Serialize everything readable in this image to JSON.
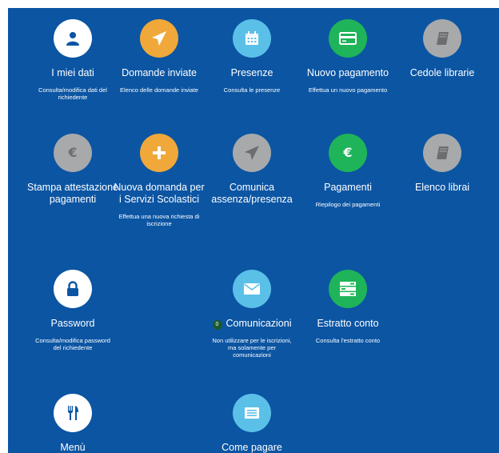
{
  "colors": {
    "panel_bg": "#0b55a3",
    "white": "#ffffff",
    "orange": "#f0a83a",
    "light_blue": "#5bc0e8",
    "green": "#1fb45a",
    "gray": "#a7a9ab"
  },
  "tiles": [
    {
      "title": "I miei dati",
      "desc": "Consulta/modifica dati del richiedente",
      "icon": "user-icon",
      "color": "white"
    },
    {
      "title": "Domande inviate",
      "desc": "Elenco delle domande inviate",
      "icon": "paper-plane-icon",
      "color": "orange"
    },
    {
      "title": "Presenze",
      "desc": "Consulta le presenze",
      "icon": "calendar-icon",
      "color": "light_blue"
    },
    {
      "title": "Nuovo pagamento",
      "desc": "Effettua un nuovo pagamento",
      "icon": "credit-card-icon",
      "color": "green"
    },
    {
      "title": "Cedole librarie",
      "desc": "",
      "icon": "book-icon",
      "color": "gray"
    },
    {
      "title": "Stampa attestazione pagamenti",
      "desc": "",
      "icon": "euro-icon",
      "color": "gray"
    },
    {
      "title": "Nuova domanda per i Servizi Scolastici",
      "desc": "Effettua una nuova richiesta di iscrizione",
      "icon": "plus-icon",
      "color": "orange"
    },
    {
      "title": "Comunica assenza/presenza",
      "desc": "",
      "icon": "paper-plane-icon",
      "color": "gray"
    },
    {
      "title": "Pagamenti",
      "desc": "Riepilogo dei pagamenti",
      "icon": "euro-icon",
      "color": "green"
    },
    {
      "title": "Elenco librai",
      "desc": "",
      "icon": "book-icon",
      "color": "gray"
    },
    {
      "title": "Password",
      "desc": "Consulta/modifica password del richiedente",
      "icon": "lock-icon",
      "color": "white"
    },
    {
      "title": "Comunicazioni",
      "badge": "0",
      "desc": "Non utilizzare per le iscrizioni, ma solamente per comunicazioni",
      "icon": "envelope-icon",
      "color": "light_blue"
    },
    {
      "title": "Estratto conto",
      "desc": "Consulta l'estratto conto",
      "icon": "list-icon",
      "color": "green"
    },
    {
      "title": "Menù",
      "desc": "",
      "icon": "cutlery-icon",
      "color": "white"
    },
    {
      "title": "Come pagare",
      "desc": "",
      "icon": "document-icon",
      "color": "light_blue"
    }
  ]
}
